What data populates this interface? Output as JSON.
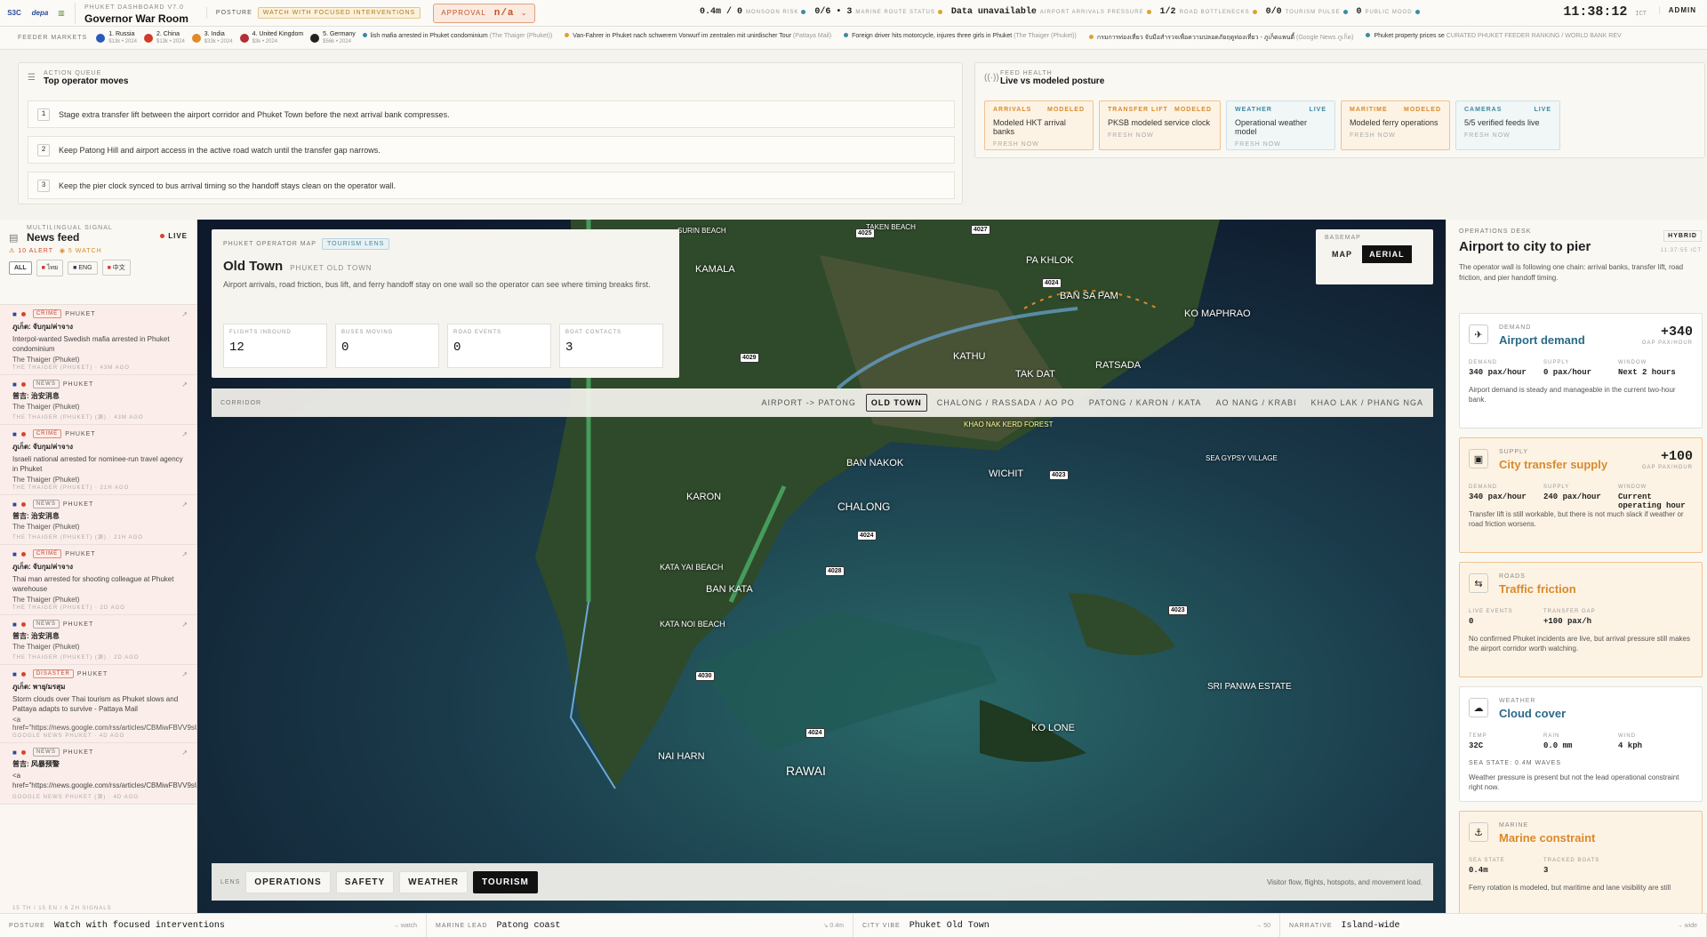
{
  "topbar": {
    "logos": [
      "S3C",
      "depa",
      "▥"
    ],
    "brand_sub": "PHUKET DASHBOARD V7.0",
    "brand_title": "Governor War Room",
    "posture_label": "POSTURE",
    "posture_chip": "WATCH WITH FOCUSED INTERVENTIONS",
    "approval_label": "APPROVAL",
    "approval_value": "n/a",
    "approval_caret": "⌄",
    "metrics": [
      {
        "value": "0.4m / 0",
        "label": "MONSOON RISK",
        "color": "#3c8aa0"
      },
      {
        "value": "0/6 • 3",
        "label": "MARINE ROUTE STATUS",
        "color": "#e0a030"
      },
      {
        "value": "Data unavailable",
        "label": "AIRPORT ARRIVALS PRESSURE",
        "color": "#e0a030"
      },
      {
        "value": "1/2",
        "label": "ROAD BOTTLENECKS",
        "color": "#e0a030"
      },
      {
        "value": "0/0",
        "label": "TOURISM PULSE",
        "color": "#3c8aa0"
      },
      {
        "value": "0",
        "label": "PUBLIC MOOD",
        "color": "#3c8aa0"
      }
    ],
    "clock": "11:38:12",
    "tz": "ICT",
    "admin": "ADMIN"
  },
  "feeder": {
    "label": "FEEDER MARKETS",
    "markets": [
      {
        "name": "1. Russia",
        "sub": "$13k • 2024",
        "color": "#2a5ab8"
      },
      {
        "name": "2. China",
        "sub": "$13k • 2024",
        "color": "#d33a2a"
      },
      {
        "name": "3. India",
        "sub": "$33k • 2024",
        "color": "#e08a2a"
      },
      {
        "name": "4. United Kingdom",
        "sub": "$3k • 2024",
        "color": "#b0303a"
      },
      {
        "name": "5. Germany",
        "sub": "$56k • 2024",
        "color": "#222222"
      }
    ],
    "news": [
      {
        "text": "lish mafia arrested in Phuket condominium",
        "src": "(The Thaiger (Phuket))"
      },
      {
        "text": "Van-Fahrer in Phuket nach schwerem Vorwurf im zentralen mit unirdischer Tour",
        "src": "(Pattaya Mail)"
      },
      {
        "text": "Foreign driver hits motorcycle, injures three girls in Phuket",
        "src": "(The Thaiger (Phuket))"
      },
      {
        "text": "กรมการท่องเที่ยว จับมือสำรวจเพื่อความปลอดภัยฤดูท่องเที่ยว - ภูเก็ตแพนดี้",
        "src": "(Google News ภูเก็ต)"
      },
      {
        "text": "Phuket property prices se",
        "src": "CURATED PHUKET FEEDER RANKING / WORLD BANK REV"
      }
    ]
  },
  "action_queue": {
    "label": "ACTION QUEUE",
    "title": "Top operator moves",
    "items": [
      {
        "n": "1",
        "text": "Stage extra transfer lift between the airport corridor and Phuket Town before the next arrival bank compresses."
      },
      {
        "n": "2",
        "text": "Keep Patong Hill and airport access in the active road watch until the transfer gap narrows."
      },
      {
        "n": "3",
        "text": "Keep the pier clock synced to bus arrival timing so the handoff stays clean on the operator wall."
      }
    ]
  },
  "feed_health": {
    "label": "FEED HEALTH",
    "title": "Live vs modeled posture",
    "cards": [
      {
        "name": "ARRIVALS",
        "state": "MODELED",
        "desc": "Modeled HKT arrival banks",
        "fresh": "FRESH NOW"
      },
      {
        "name": "TRANSFER LIFT",
        "state": "MODELED",
        "desc": "PKSB modeled service clock",
        "fresh": "FRESH NOW"
      },
      {
        "name": "WEATHER",
        "state": "LIVE",
        "desc": "Operational weather model",
        "fresh": "FRESH NOW"
      },
      {
        "name": "MARITIME",
        "state": "MODELED",
        "desc": "Modeled ferry operations",
        "fresh": "FRESH NOW"
      },
      {
        "name": "CAMERAS",
        "state": "LIVE",
        "desc": "5/5 verified feeds live",
        "fresh": "FRESH NOW"
      }
    ]
  },
  "news_feed": {
    "label": "MULTILINGUAL SIGNAL",
    "title": "News feed",
    "live": "LIVE",
    "alert": "10 ALERT",
    "watch": "5 WATCH",
    "tabs": [
      "ALL",
      "ไทย",
      "ENG",
      "中文"
    ],
    "footer": "15 TH / 15 EN / 6 ZH SIGNALS",
    "items": [
      {
        "tag": "CRIME",
        "loc": "PHUKET",
        "title": "ภูเก็ต: จับกุม/ค่าจาง",
        "body": "Interpol-wanted Swedish mafia arrested in Phuket condominium",
        "src": "The Thaiger (Phuket)",
        "meta": "THE THAIGER (PHUKET) · 43M AGO"
      },
      {
        "tag": "NEWS",
        "loc": "PHUKET",
        "title": "普吉: 治安消息",
        "body": "",
        "src": "The Thaiger (Phuket)",
        "meta": "THE THAIGER (PHUKET) (源) · 43M AGO"
      },
      {
        "tag": "CRIME",
        "loc": "PHUKET",
        "title": "ภูเก็ต: จับกุม/ค่าจาง",
        "body": "Israeli national arrested for nominee-run travel agency in Phuket",
        "src": "The Thaiger (Phuket)",
        "meta": "THE THAIGER (PHUKET) · 21H AGO"
      },
      {
        "tag": "NEWS",
        "loc": "PHUKET",
        "title": "普吉: 治安消息",
        "body": "",
        "src": "The Thaiger (Phuket)",
        "meta": "THE THAIGER (PHUKET) (源) · 21H AGO"
      },
      {
        "tag": "CRIME",
        "loc": "PHUKET",
        "title": "ภูเก็ต: จับกุม/ค่าจาง",
        "body": "Thai man arrested for shooting colleague at Phuket warehouse",
        "src": "The Thaiger (Phuket)",
        "meta": "THE THAIGER (PHUKET) · 2D AGO"
      },
      {
        "tag": "NEWS",
        "loc": "PHUKET",
        "title": "普吉: 治安消息",
        "body": "",
        "src": "The Thaiger (Phuket)",
        "meta": "THE THAIGER (PHUKET) (源) · 2D AGO"
      },
      {
        "tag": "DISASTER",
        "loc": "PHUKET",
        "title": "ภูเก็ต: พายุ/มรสุม",
        "body": "Storm clouds over Thai tourism as Phuket slows and Pattaya adapts to survive - Pattaya Mail",
        "src": "<a href=\"https://news.google.com/rss/articles/CBMiwFBVV9sU",
        "meta": "GOOGLE NEWS PHUKET · 4D AGO"
      },
      {
        "tag": "NEWS",
        "loc": "PHUKET",
        "title": "普吉: 风暴预警",
        "body": "<a href=\"https://news.google.com/rss/articles/CBMiwFBVV9sU",
        "src": "",
        "meta": "GOOGLE NEWS PHUKET (源) · 4D AGO"
      }
    ]
  },
  "map": {
    "card_label": "PHUKET OPERATOR MAP",
    "lens_chip": "TOURISM LENS",
    "title": "Old Town",
    "subtitle": "PHUKET OLD TOWN",
    "desc": "Airport arrivals, road friction, bus lift, and ferry handoff stay on one wall so the operator can see where timing breaks first.",
    "kpis": [
      {
        "label": "FLIGHTS INBOUND",
        "value": "12"
      },
      {
        "label": "BUSES MOVING",
        "value": "0"
      },
      {
        "label": "ROAD EVENTS",
        "value": "0"
      },
      {
        "label": "BOAT CONTACTS",
        "value": "3"
      }
    ],
    "basemap_label": "BASEMAP",
    "basemap_opts": [
      "MAP",
      "AERIAL"
    ],
    "basemap_active": "AERIAL",
    "corridor_label": "CORRIDOR",
    "corridors": [
      "AIRPORT -> PATONG",
      "OLD TOWN",
      "CHALONG / RASSADA / AO PO",
      "PATONG / KARON / KATA",
      "AO NANG / KRABI",
      "KHAO LAK / PHANG NGA"
    ],
    "corridor_active": "OLD TOWN",
    "lens_label": "LENS",
    "lenses": [
      "OPERATIONS",
      "SAFETY",
      "WEATHER",
      "TOURISM"
    ],
    "lens_active": "TOURISM",
    "lens_desc": "Visitor flow, flights, hotspots, and movement load.",
    "places": [
      "SURIN BEACH",
      "KAMALA",
      "TAKEN BEACH",
      "PA KHLOK",
      "BAN SA PAM",
      "KO MAPHRAO",
      "KATHU",
      "TAK DAT",
      "RATSADA",
      "KHAO NAK KERD FOREST",
      "BAN NAKOK",
      "WICHIT",
      "SEA GYPSY VILLAGE",
      "KARON",
      "CHALONG",
      "KATA YAI BEACH",
      "BAN KATA",
      "KATA NOI BEACH",
      "NAI HARN",
      "RAWAI",
      "KO LONE",
      "SRI PANWA ESTATE"
    ],
    "roads": [
      "4025",
      "4027",
      "4029",
      "4024",
      "4023",
      "4028",
      "4030",
      "4024",
      "4024",
      "4023"
    ]
  },
  "ops": {
    "label": "OPERATIONS DESK",
    "mode": "HYBRID",
    "time": "11:37:55 ICT",
    "title": "Airport to city to pier",
    "desc": "The operator wall is following one chain: arrival banks, transfer lift, road friction, and pier handoff timing.",
    "cards": [
      {
        "lab": "DEMAND",
        "nm": "Airport demand",
        "val": "+340",
        "vl": "GAP PAX/HOUR",
        "cols": [
          [
            "DEMAND",
            "340 pax/hour"
          ],
          [
            "SUPPLY",
            "0 pax/hour"
          ],
          [
            "WINDOW",
            "Next 2 hours"
          ]
        ],
        "desc": "Airport demand is steady and manageable in the current two-hour bank.",
        "color": "#2a6a8a",
        "icon": "✈"
      },
      {
        "lab": "SUPPLY",
        "nm": "City transfer supply",
        "val": "+100",
        "vl": "GAP PAX/HOUR",
        "cols": [
          [
            "DEMAND",
            "340 pax/hour"
          ],
          [
            "SUPPLY",
            "240 pax/hour"
          ],
          [
            "WINDOW",
            "Current operating hour"
          ]
        ],
        "desc": "Transfer lift is still workable, but there is not much slack if weather or road friction worsens.",
        "color": "#d98a2b",
        "icon": "▣"
      },
      {
        "lab": "ROADS",
        "nm": "Traffic friction",
        "val": "",
        "vl": "",
        "cols": [
          [
            "LIVE EVENTS",
            "0"
          ],
          [
            "TRANSFER GAP",
            "+100 pax/h"
          ],
          [
            "",
            ""
          ]
        ],
        "desc": "No confirmed Phuket incidents are live, but arrival pressure still makes the airport corridor worth watching.",
        "color": "#d98a2b",
        "icon": "⇆"
      },
      {
        "lab": "WEATHER",
        "nm": "Cloud cover",
        "val": "",
        "vl": "",
        "cols": [
          [
            "TEMP",
            "32C"
          ],
          [
            "RAIN",
            "0.0 mm"
          ],
          [
            "WIND",
            "4 kph"
          ]
        ],
        "sea": "SEA STATE: 0.4M WAVES",
        "desc": "Weather pressure is present but not the lead operational constraint right now.",
        "color": "#2a6a8a",
        "icon": "☁"
      },
      {
        "lab": "MARINE",
        "nm": "Marine constraint",
        "val": "",
        "vl": "",
        "cols": [
          [
            "SEA STATE",
            "0.4m"
          ],
          [
            "TRACKED BOATS",
            "3"
          ],
          [
            "",
            ""
          ]
        ],
        "desc": "Ferry rotation is modeled, but maritime and lane visibility are still",
        "color": "#d98a2b",
        "icon": "⚓"
      }
    ]
  },
  "bottom": [
    {
      "l": "POSTURE",
      "v": "Watch with focused interventions",
      "r": "→ watch"
    },
    {
      "l": "MARINE LEAD",
      "v": "Patong coast",
      "r": "↘ 0.4m"
    },
    {
      "l": "CITY VIBE",
      "v": "Phuket Old Town",
      "r": "→ 50"
    },
    {
      "l": "NARRATIVE",
      "v": "Island-wide",
      "r": "→ wide"
    }
  ]
}
